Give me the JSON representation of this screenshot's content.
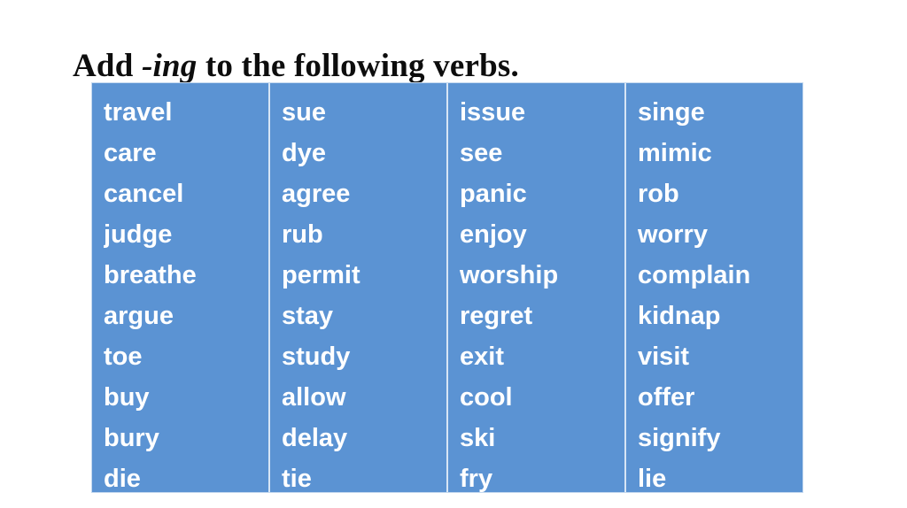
{
  "slide": {
    "title_prefix": "Add ",
    "title_italic": "-ing",
    "title_suffix": " to the following verbs.",
    "background_color": "#ffffff"
  },
  "table": {
    "fill_color": "#5b93d3",
    "divider_color": "#d7e5f5",
    "text_color": "#ffffff",
    "columns": [
      {
        "index": 1,
        "words": [
          "travel",
          "care",
          "cancel",
          "judge",
          "breathe",
          "argue",
          "toe",
          "buy",
          "bury",
          "die"
        ]
      },
      {
        "index": 2,
        "words": [
          "sue",
          "dye",
          "agree",
          "rub",
          "permit",
          "stay",
          "study",
          "allow",
          "delay",
          "tie"
        ]
      },
      {
        "index": 3,
        "words": [
          "issue",
          "see",
          "panic",
          "enjoy",
          "worship",
          "regret",
          "exit",
          "cool",
          "ski",
          "fry"
        ]
      },
      {
        "index": 4,
        "words": [
          "singe",
          "mimic",
          "rob",
          "worry",
          "complain",
          "kidnap",
          "visit",
          "offer",
          "signify",
          "lie"
        ]
      }
    ]
  }
}
